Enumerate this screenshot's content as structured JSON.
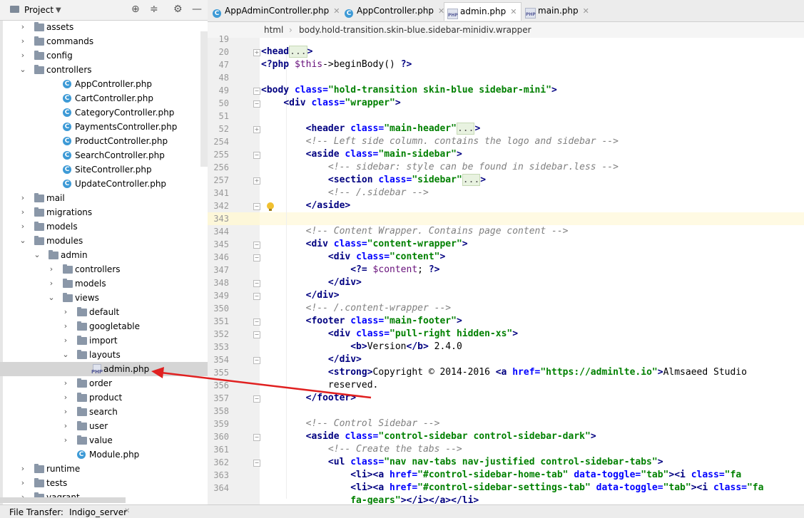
{
  "project_panel": {
    "title": "Project",
    "tree": [
      {
        "label": "assets",
        "type": "folder",
        "depth": 0,
        "expanded": false
      },
      {
        "label": "commands",
        "type": "folder",
        "depth": 0,
        "expanded": false
      },
      {
        "label": "config",
        "type": "folder",
        "depth": 0,
        "expanded": false
      },
      {
        "label": "controllers",
        "type": "folder",
        "depth": 0,
        "expanded": true
      },
      {
        "label": "AppController.php",
        "type": "class",
        "depth": 1
      },
      {
        "label": "CartController.php",
        "type": "class",
        "depth": 1
      },
      {
        "label": "CategoryController.php",
        "type": "class",
        "depth": 1
      },
      {
        "label": "PaymentsController.php",
        "type": "class",
        "depth": 1
      },
      {
        "label": "ProductController.php",
        "type": "class",
        "depth": 1
      },
      {
        "label": "SearchController.php",
        "type": "class",
        "depth": 1
      },
      {
        "label": "SiteController.php",
        "type": "class",
        "depth": 1
      },
      {
        "label": "UpdateController.php",
        "type": "class",
        "depth": 1
      },
      {
        "label": "mail",
        "type": "folder",
        "depth": 0,
        "expanded": false
      },
      {
        "label": "migrations",
        "type": "folder",
        "depth": 0,
        "expanded": false
      },
      {
        "label": "models",
        "type": "folder",
        "depth": 0,
        "expanded": false
      },
      {
        "label": "modules",
        "type": "folder",
        "depth": 0,
        "expanded": true
      },
      {
        "label": "admin",
        "type": "folder",
        "depth": 1,
        "expanded": true
      },
      {
        "label": "controllers",
        "type": "folder",
        "depth": 2,
        "expanded": false
      },
      {
        "label": "models",
        "type": "folder",
        "depth": 2,
        "expanded": false
      },
      {
        "label": "views",
        "type": "folder",
        "depth": 2,
        "expanded": true
      },
      {
        "label": "default",
        "type": "folder",
        "depth": 3,
        "expanded": false
      },
      {
        "label": "googletable",
        "type": "folder",
        "depth": 3,
        "expanded": false
      },
      {
        "label": "import",
        "type": "folder",
        "depth": 3,
        "expanded": false
      },
      {
        "label": "layouts",
        "type": "folder",
        "depth": 3,
        "expanded": true
      },
      {
        "label": "admin.php",
        "type": "php",
        "depth": 4,
        "selected": true
      },
      {
        "label": "order",
        "type": "folder",
        "depth": 3,
        "expanded": false
      },
      {
        "label": "product",
        "type": "folder",
        "depth": 3,
        "expanded": false
      },
      {
        "label": "search",
        "type": "folder",
        "depth": 3,
        "expanded": false
      },
      {
        "label": "user",
        "type": "folder",
        "depth": 3,
        "expanded": false
      },
      {
        "label": "value",
        "type": "folder",
        "depth": 3,
        "expanded": false
      },
      {
        "label": "Module.php",
        "type": "class",
        "depth": 2
      },
      {
        "label": "runtime",
        "type": "folder",
        "depth": 0,
        "expanded": false
      },
      {
        "label": "tests",
        "type": "folder",
        "depth": 0,
        "expanded": false
      },
      {
        "label": "vagrant",
        "type": "folder",
        "depth": 0,
        "expanded": false
      }
    ]
  },
  "tabs": [
    {
      "label": "AppAdminController.php",
      "icon": "class-icon",
      "active": false
    },
    {
      "label": "AppController.php",
      "icon": "class-icon",
      "active": false
    },
    {
      "label": "admin.php",
      "icon": "php-file-icon",
      "active": true
    },
    {
      "label": "main.php",
      "icon": "php-file-icon",
      "active": false
    }
  ],
  "breadcrumb": [
    "html",
    "body.hold-transition.skin-blue.sidebar-mini",
    "div.wrapper"
  ],
  "line_numbers": [
    "19",
    "20",
    "47",
    "48",
    "49",
    "50",
    "51",
    "52",
    "254",
    "255",
    "256",
    "257",
    "341",
    "342",
    "343",
    "344",
    "345",
    "346",
    "347",
    "348",
    "349",
    "350",
    "351",
    "352",
    "353",
    "354",
    "355",
    "356",
    "357",
    "358",
    "359",
    "360",
    "361",
    "362",
    "363",
    "364"
  ],
  "bottom_bar": {
    "file_transfer": "File Transfer:",
    "server": "Indigo_server"
  }
}
